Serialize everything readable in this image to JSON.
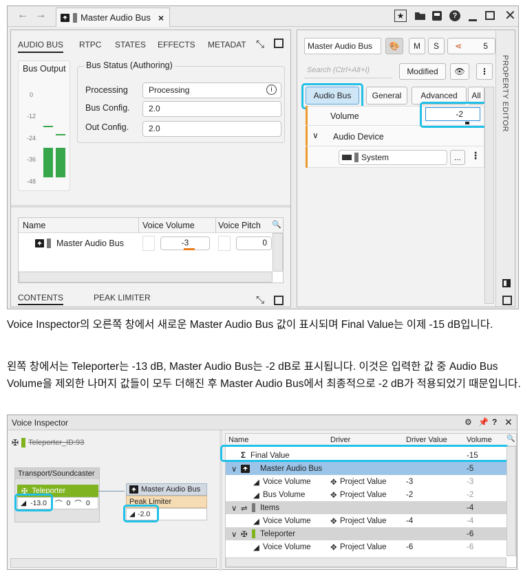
{
  "top_window": {
    "nav": {
      "back": "←",
      "forward": "→"
    },
    "tab_title": "Master Audio Bus",
    "tab_close": "×",
    "left": {
      "tabs": [
        "AUDIO BUS",
        "RTPC",
        "STATES",
        "EFFECTS",
        "METADAT"
      ],
      "bus_output": {
        "title": "Bus Output",
        "scale": [
          "0",
          "-12",
          "-24",
          "-36",
          "-48"
        ]
      },
      "bus_status": {
        "title": "Bus Status (Authoring)",
        "rows": [
          {
            "label": "Processing",
            "value": "Processing"
          },
          {
            "label": "Bus Config.",
            "value": "2.0"
          },
          {
            "label": "Out Config.",
            "value": "2.0"
          }
        ]
      },
      "table": {
        "headers": [
          "Name",
          "Voice Volume",
          "Voice Pitch"
        ],
        "row": {
          "name": "Master Audio Bus",
          "volume": "-3",
          "pitch": "0"
        }
      },
      "bottom_tabs": [
        "CONTENTS",
        "PEAK LIMITER"
      ]
    },
    "right": {
      "object_name": "Master Audio Bus",
      "m": "M",
      "s": "S",
      "share_count": "5",
      "search_placeholder": "Search (Ctrl+Alt+I)",
      "modified": "Modified",
      "tabs": [
        "Audio Bus",
        "General",
        "Advanced",
        "All"
      ],
      "volume": {
        "label": "Volume",
        "value": "-2"
      },
      "audio_device": {
        "label": "Audio Device",
        "value": "System",
        "browse": "..."
      },
      "side_label": "PROPERTY EDITOR"
    }
  },
  "paragraph1": "Voice Inspector의 오른쪽 창에서 새로운 Master Audio Bus 값이 표시되며 Final Value는 이제 -15 dB입니다.",
  "paragraph2": "왼쪽 창에서는 Teleporter는 -13 dB, Master Audio Bus는 -2 dB로 표시됩니다. 이것은 입력한 값 중 Audio Bus Volume을 제외한 나머지 값들이 모두 더해진 후 Master Audio Bus에서 최종적으로 -2 dB가 적용되었기 때문입니다.",
  "voice_inspector": {
    "title": "Voice Inspector",
    "header_item": "Teleporter_ID:93",
    "graph": {
      "group": "Transport/Soundcaster",
      "teleporter": {
        "name": "Teleporter",
        "volume": "-13.0",
        "lpf": "0",
        "hpf": "0"
      },
      "bus": {
        "name": "Master Audio Bus",
        "effect": "Peak Limiter",
        "volume": "-2.0"
      }
    },
    "table": {
      "headers": [
        "Name",
        "Driver",
        "Driver Value",
        "Volume"
      ],
      "rows": [
        {
          "name": "Final Value",
          "driver": "",
          "driver_value": "",
          "volume": "-15"
        },
        {
          "name": "Master Audio Bus",
          "driver": "",
          "driver_value": "",
          "volume": "-5"
        },
        {
          "name": "Voice Volume",
          "driver": "Project Value",
          "driver_value": "-3",
          "volume": "-3"
        },
        {
          "name": "Bus Volume",
          "driver": "Project Value",
          "driver_value": "-2",
          "volume": "-2"
        },
        {
          "name": "Items",
          "driver": "",
          "driver_value": "",
          "volume": "-4"
        },
        {
          "name": "Voice Volume",
          "driver": "Project Value",
          "driver_value": "-4",
          "volume": "-4"
        },
        {
          "name": "Teleporter",
          "driver": "",
          "driver_value": "",
          "volume": "-6"
        },
        {
          "name": "Voice Volume",
          "driver": "Project Value",
          "driver_value": "-6",
          "volume": "-6"
        }
      ]
    }
  }
}
